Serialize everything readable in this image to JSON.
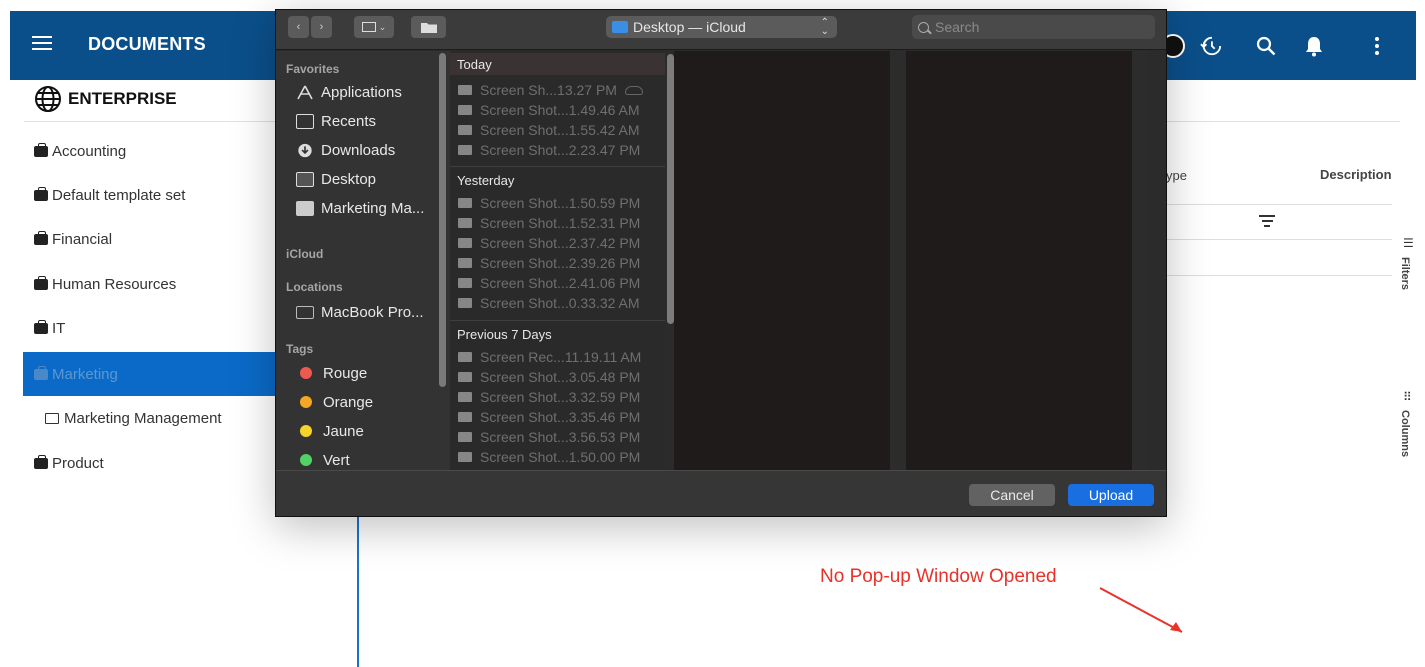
{
  "app": {
    "title": "DOCUMENTS",
    "section": "ENTERPRISE",
    "nav": [
      {
        "label": "Accounting",
        "type": "cabinet"
      },
      {
        "label": "Default template set",
        "type": "cabinet"
      },
      {
        "label": "Financial",
        "type": "cabinet"
      },
      {
        "label": "Human Resources",
        "type": "cabinet"
      },
      {
        "label": "IT",
        "type": "cabinet"
      },
      {
        "label": "Marketing",
        "type": "cabinet",
        "active": true
      },
      {
        "label": "Marketing Management",
        "type": "folder"
      },
      {
        "label": "Product",
        "type": "cabinet"
      }
    ],
    "columns": {
      "type_header": "ype",
      "description_header": "Description"
    },
    "side_tabs": {
      "filters": "Filters",
      "columns": "Columns"
    },
    "colors": {
      "appbar": "#0b4f8a",
      "active_nav": "#0b6ac7"
    }
  },
  "dialog": {
    "location": "Desktop — iCloud",
    "search_placeholder": "Search",
    "sidebar": {
      "favorites_header": "Favorites",
      "favorites": [
        "Applications",
        "Recents",
        "Downloads",
        "Desktop",
        "Marketing Ma..."
      ],
      "icloud_header": "iCloud",
      "locations_header": "Locations",
      "locations": [
        "MacBook Pro..."
      ],
      "tags_header": "Tags",
      "tags": [
        {
          "label": "Rouge",
          "color": "#ee5a50"
        },
        {
          "label": "Orange",
          "color": "#f5a623"
        },
        {
          "label": "Jaune",
          "color": "#f5d327"
        },
        {
          "label": "Vert",
          "color": "#4fd364"
        }
      ]
    },
    "groups": [
      {
        "title": "Today",
        "files": [
          "Screen Sh...13.27 PM",
          "Screen Shot...1.49.46 AM",
          "Screen Shot...1.55.42 AM",
          "Screen Shot...2.23.47 PM"
        ]
      },
      {
        "title": "Yesterday",
        "files": [
          "Screen Shot...1.50.59 PM",
          "Screen Shot...1.52.31 PM",
          "Screen Shot...2.37.42 PM",
          "Screen Shot...2.39.26 PM",
          "Screen Shot...2.41.06 PM",
          "Screen Shot...0.33.32 AM"
        ]
      },
      {
        "title": "Previous 7 Days",
        "files": [
          "Screen Rec...11.19.11 AM",
          "Screen Shot...3.05.48 PM",
          "Screen Shot...3.32.59 PM",
          "Screen Shot...3.35.46 PM",
          "Screen Shot...3.56.53 PM",
          "Screen Shot...1.50.00 PM"
        ]
      }
    ],
    "cancel_label": "Cancel",
    "upload_label": "Upload"
  },
  "annotation": "No Pop-up Window Opened"
}
